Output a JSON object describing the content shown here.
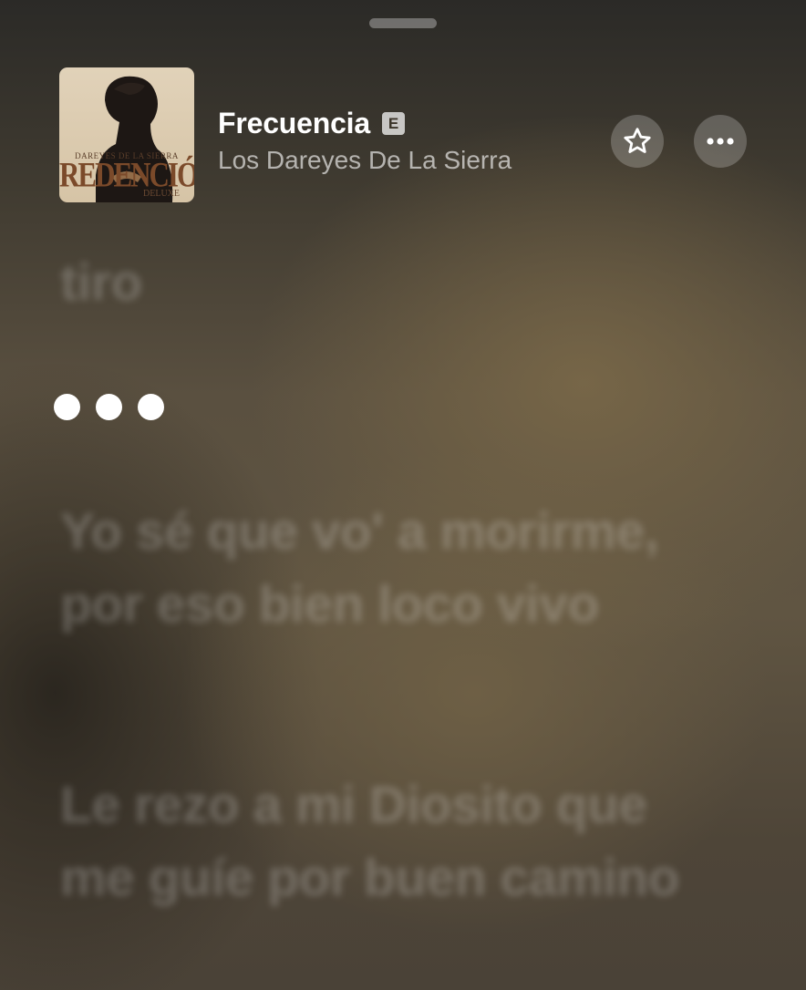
{
  "now_playing": {
    "title": "Frecuencia",
    "explicit_badge": "E",
    "artist": "Los Dareyes De La Sierra",
    "album_art": {
      "line_top": "DAREYES DE LA SIERRA",
      "title": "REDENCIÓN",
      "edition": "DELUXE"
    }
  },
  "actions": {
    "favorite_icon": "star-icon",
    "more_icon": "ellipsis-icon"
  },
  "lyrics": {
    "previous_line": "tiro",
    "interlude_dots": 3,
    "next_line_1": "Yo sé que vo' a morirme, por eso bien loco vivo",
    "next_line_2": "Le rezo a mi Diosito que me guíe por buen camino"
  },
  "colors": {
    "background_top": "#2b2a27",
    "background_mid": "#605542",
    "badge": "#bfbcb6"
  }
}
